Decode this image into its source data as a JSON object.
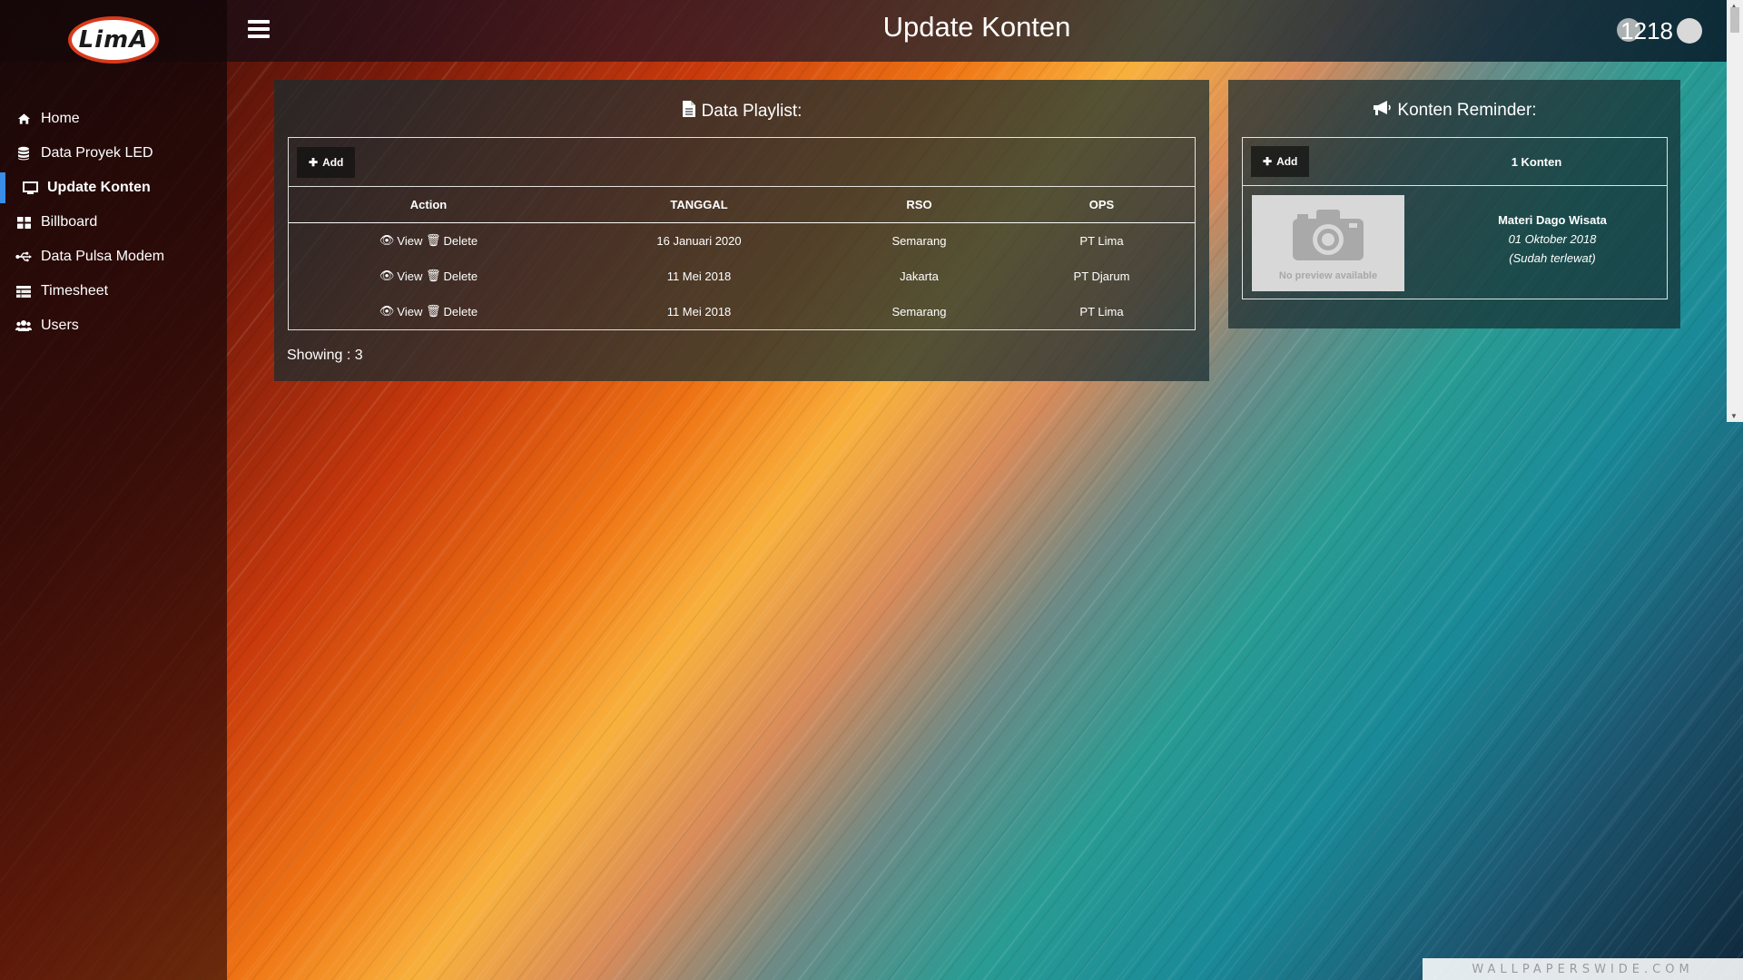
{
  "app": {
    "logo_text": "LimA",
    "page_title": "Update Konten",
    "user_count": "1218"
  },
  "sidebar": {
    "items": [
      {
        "label": "Home",
        "icon": "home-icon"
      },
      {
        "label": "Data Proyek LED",
        "icon": "database-icon"
      },
      {
        "label": "Update Konten",
        "icon": "monitor-icon",
        "active": true
      },
      {
        "label": "Billboard",
        "icon": "grid-icon"
      },
      {
        "label": "Data Pulsa Modem",
        "icon": "usb-icon"
      },
      {
        "label": "Timesheet",
        "icon": "table-icon"
      },
      {
        "label": "Users",
        "icon": "users-icon"
      }
    ]
  },
  "playlist": {
    "title": "Data Playlist:",
    "add_label": "Add",
    "columns": [
      "Action",
      "TANGGAL",
      "RSO",
      "OPS"
    ],
    "view_label": "View",
    "delete_label": "Delete",
    "rows": [
      {
        "tanggal": "16 Januari 2020",
        "rso": "Semarang",
        "ops": "PT Lima"
      },
      {
        "tanggal": "11 Mei 2018",
        "rso": "Jakarta",
        "ops": "PT Djarum"
      },
      {
        "tanggal": "11 Mei 2018",
        "rso": "Semarang",
        "ops": "PT Lima"
      }
    ],
    "showing": "Showing : 3"
  },
  "reminder": {
    "title": "Konten Reminder:",
    "add_label": "Add",
    "count": "1 Konten",
    "preview_caption": "No preview available",
    "item_title": "Materi Dago Wisata",
    "item_date": "01 Oktober 2018",
    "item_status": "(Sudah terlewat)"
  },
  "watermark": "WALLPAPERSWIDE.COM"
}
